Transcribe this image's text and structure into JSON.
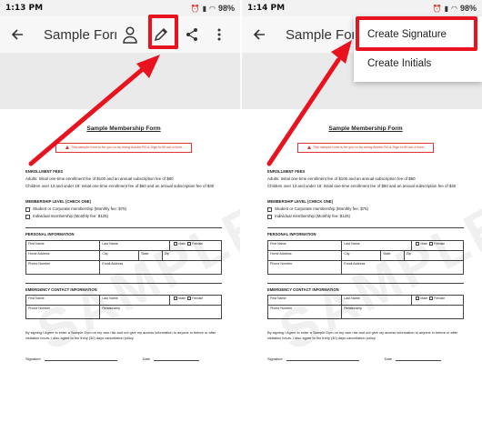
{
  "screens": [
    {
      "status": {
        "time": "1:13 PM",
        "battery": "98%"
      },
      "app_bar": {
        "title": "Sample Form"
      }
    },
    {
      "status": {
        "time": "1:14 PM",
        "battery": "98%"
      },
      "app_bar": {
        "title": "Sample Form"
      },
      "menu": {
        "items": [
          "Create Signature",
          "Create Initials"
        ]
      }
    }
  ],
  "document": {
    "title": "Sample Membership Form",
    "warning": "This sample form is for you to try using Adobe Fill & Sign to fill out a form",
    "enrollment_fees": {
      "heading": "ENROLLMENT FEES",
      "lines": [
        "Adults: Initial one-time enrollment fee of $100 and an annual subscription fee of $80",
        "Children over 13 and under 18: Initial one-time enrollment fee of $50 and an annual subscription fee of $40"
      ]
    },
    "membership_level": {
      "heading": "MEMBERSHIP LEVEL (CHECK ONE)",
      "options": [
        "Student or Corporate membership (Monthly fee: $75)",
        "Individual membership (Monthly fee: $125)"
      ]
    },
    "personal_info": {
      "heading": "PERSONAL INFORMATION",
      "fields": {
        "first_name": "First Name",
        "last_name": "Last Name",
        "male": "Male",
        "female": "Female",
        "home_address": "Home Address",
        "city": "City",
        "state": "State",
        "zip": "Zip",
        "phone": "Phone Number",
        "email": "Email Address"
      }
    },
    "emergency_contact": {
      "heading": "EMERGENCY CONTACT INFORMATION",
      "fields": {
        "first_name": "First Name",
        "last_name": "Last Name",
        "male": "Male",
        "female": "Female",
        "phone": "Phone Number",
        "relationship": "Relationship"
      }
    },
    "consent": "By signing I Agree to enter a Sample Gym on my own risk and not give my access information to anyone in before or after visitation hours. I also agree to the thirty (30) days cancellation policy.",
    "signature_label": "Signature",
    "date_label": "Date",
    "watermark": "SAMPLE"
  },
  "colors": {
    "highlight": "#e8131f",
    "warning": "#d33333"
  }
}
